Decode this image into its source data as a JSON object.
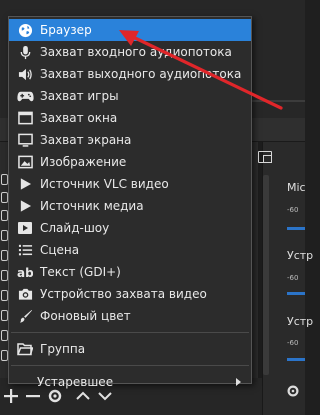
{
  "menu": {
    "items": [
      {
        "label": "Браузер",
        "icon": "globe-icon"
      },
      {
        "label": "Захват входного аудиопотока",
        "icon": "microphone-icon"
      },
      {
        "label": "Захват выходного аудиопотока",
        "icon": "speaker-icon"
      },
      {
        "label": "Захват игры",
        "icon": "gamepad-icon"
      },
      {
        "label": "Захват окна",
        "icon": "window-icon"
      },
      {
        "label": "Захват экрана",
        "icon": "monitor-icon"
      },
      {
        "label": "Изображение",
        "icon": "image-icon"
      },
      {
        "label": "Источник VLC видео",
        "icon": "play-icon"
      },
      {
        "label": "Источник медиа",
        "icon": "play-icon"
      },
      {
        "label": "Слайд-шоу",
        "icon": "slideshow-icon"
      },
      {
        "label": "Сцена",
        "icon": "list-icon"
      },
      {
        "label": "Текст (GDI+)",
        "icon": "text-icon"
      },
      {
        "label": "Устройство захвата видео",
        "icon": "camera-icon"
      },
      {
        "label": "Фоновый цвет",
        "icon": "brush-icon"
      }
    ],
    "group_label": "Группа",
    "deprecated_label": "Устаревшее",
    "highlight_color": "#2a82da"
  },
  "mixer": {
    "channels": [
      {
        "label": "Mic",
        "db": "-60"
      },
      {
        "label": "Устр",
        "db": "-60"
      },
      {
        "label": "Устр",
        "db": "-60"
      }
    ],
    "meter_color": "#2b74c9"
  },
  "annotation": {
    "color": "#e0262a"
  }
}
